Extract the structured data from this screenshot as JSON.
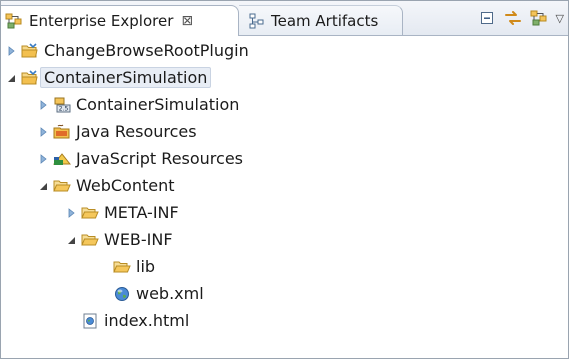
{
  "tabs": [
    {
      "label": "Enterprise Explorer",
      "icon": "enterprise-explorer-icon",
      "active": true,
      "close": "⊠"
    },
    {
      "label": "Team Artifacts",
      "icon": "team-artifacts-icon",
      "active": false
    }
  ],
  "toolbar": {
    "buttons": [
      "collapse-all-icon",
      "link-with-editor-icon",
      "new-icon"
    ],
    "menu_glyph": "▽"
  },
  "tree": [
    {
      "label": "ChangeBrowseRootPlugin",
      "level": 0,
      "state": "collapsed",
      "icon": "project-folder-icon"
    },
    {
      "label": "ContainerSimulation",
      "level": 0,
      "state": "expanded",
      "icon": "project-folder-icon",
      "selected": true
    },
    {
      "label": "ContainerSimulation",
      "level": 1,
      "state": "collapsed",
      "icon": "deployment-descriptor-icon"
    },
    {
      "label": "Java Resources",
      "level": 1,
      "state": "collapsed",
      "icon": "java-resources-icon"
    },
    {
      "label": "JavaScript Resources",
      "level": 1,
      "state": "collapsed",
      "icon": "javascript-resources-icon"
    },
    {
      "label": "WebContent",
      "level": 1,
      "state": "expanded",
      "icon": "folder-open-icon"
    },
    {
      "label": "META-INF",
      "level": 2,
      "state": "collapsed",
      "icon": "folder-open-icon"
    },
    {
      "label": "WEB-INF",
      "level": 2,
      "state": "expanded",
      "icon": "folder-open-icon"
    },
    {
      "label": "lib",
      "level": 3,
      "state": "none",
      "icon": "folder-open-icon"
    },
    {
      "label": "web.xml",
      "level": 3,
      "state": "none",
      "icon": "globe-file-icon"
    },
    {
      "label": "index.html",
      "level": 2,
      "state": "none",
      "icon": "html-file-icon"
    }
  ],
  "colors": {
    "folder": "#f1c25a",
    "twisty_collapsed": "#8fb3d9",
    "twisty_expanded": "#444444"
  }
}
